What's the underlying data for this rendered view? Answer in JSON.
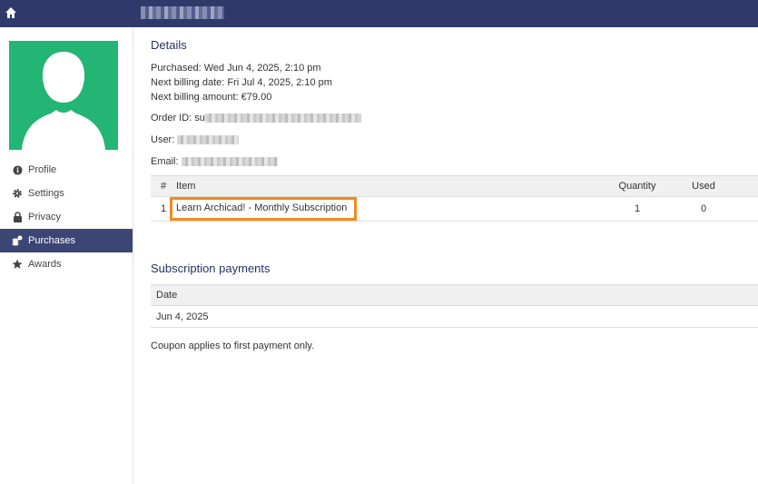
{
  "topbar": {
    "username": ""
  },
  "sidebar": {
    "items": [
      {
        "label": "Profile",
        "icon": "info-icon"
      },
      {
        "label": "Settings",
        "icon": "gear-icon"
      },
      {
        "label": "Privacy",
        "icon": "lock-icon"
      },
      {
        "label": "Purchases",
        "icon": "coins-icon",
        "active": true
      },
      {
        "label": "Awards",
        "icon": "star-icon"
      }
    ]
  },
  "details": {
    "heading": "Details",
    "purchased": "Purchased: Wed Jun 4, 2025, 2:10 pm",
    "next_billing_date": "Next billing date: Fri Jul 4, 2025, 2:10 pm",
    "next_billing_amount": "Next billing amount: €79.00",
    "order_id_label": "Order ID: su",
    "user_label": "User:",
    "email_label": "Email:"
  },
  "items_table": {
    "headers": {
      "num": "#",
      "item": "Item",
      "quantity": "Quantity",
      "used": "Used"
    },
    "rows": [
      {
        "num": "1",
        "item": "Learn Archicad! - Monthly Subscription",
        "quantity": "1",
        "used": "0"
      }
    ]
  },
  "subscription": {
    "heading": "Subscription payments",
    "headers": {
      "date": "Date"
    },
    "rows": [
      {
        "date": "Jun 4, 2025"
      }
    ],
    "note": "Coupon applies to first payment only."
  },
  "colors": {
    "topbar": "#2f3a6b",
    "active_nav": "#3c4675",
    "avatar_bg": "#22b573",
    "highlight": "#f28a1c",
    "heading": "#283260"
  }
}
